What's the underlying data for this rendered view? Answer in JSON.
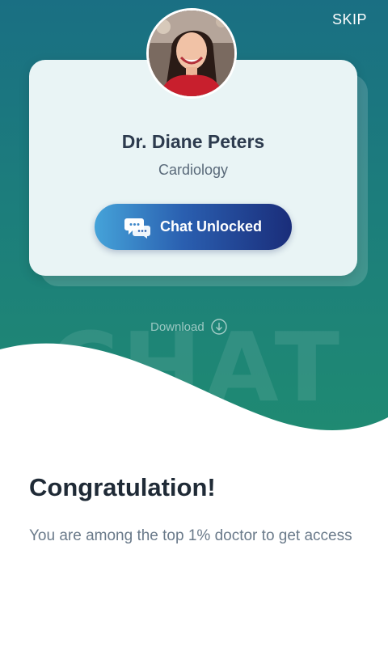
{
  "header": {
    "skip_label": "SKIP"
  },
  "watermark": {
    "text": "CHAT"
  },
  "doctor": {
    "name": "Dr. Diane Peters",
    "specialty": "Cardiology"
  },
  "chat_button": {
    "label": "Chat Unlocked",
    "icon": "chat-bubbles-icon"
  },
  "download": {
    "label": "Download",
    "icon": "download-circle-icon"
  },
  "congrats": {
    "title": "Congratulation!",
    "message": "You are among the top 1% doctor to get access"
  },
  "colors": {
    "hero_top": "#1a6f83",
    "hero_bottom": "#1f8a72",
    "button_start": "#45a3d9",
    "button_end": "#1a2d7a",
    "card": "#e9f4f5"
  }
}
